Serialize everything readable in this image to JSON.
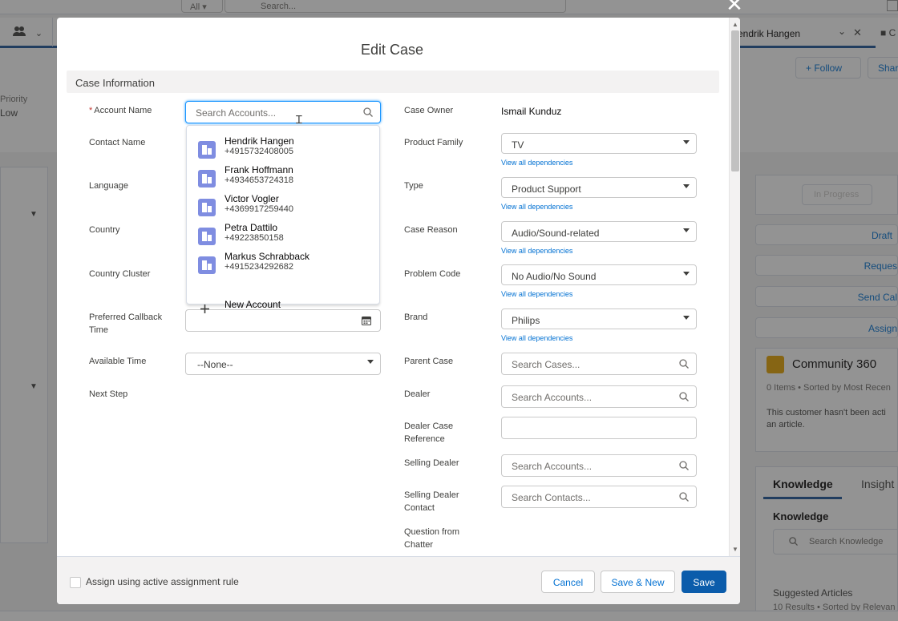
{
  "background": {
    "search_scope": "All",
    "search_placeholder": "Search...",
    "tab_right_label": "endrik Hangen",
    "tab_more_label": "C",
    "priority_label": "Priority",
    "priority_value": "Low",
    "follow_label": "Follow",
    "share_label": "Shar",
    "status_button": "In Progress",
    "actions": [
      "Draft",
      "Reques",
      "Send Cal",
      "Assign"
    ],
    "community_title": "Community 360",
    "community_meta": "0 Items • Sorted by Most Recen",
    "community_text": "This customer hasn't been acti an article.",
    "knowledge_tab": "Knowledge",
    "insights_tab": "Insight",
    "knowledge_heading": "Knowledge",
    "knowledge_search_placeholder": "Search Knowledge",
    "suggested_articles": "Suggested Articles",
    "suggested_meta": "10 Results • Sorted by Relevan"
  },
  "modal": {
    "title": "Edit Case",
    "section_title": "Case Information",
    "left_fields": {
      "account_name_label": "Account Name",
      "account_name_placeholder": "Search Accounts...",
      "contact_name_label": "Contact Name",
      "language_label": "Language",
      "country_label": "Country",
      "country_cluster_label": "Country Cluster",
      "preferred_callback_label": "Preferred Callback Time",
      "available_time_label": "Available Time",
      "available_time_value": "--None--",
      "next_step_label": "Next Step"
    },
    "account_lookup": {
      "results": [
        {
          "name": "Hendrik Hangen",
          "phone": "+4915732408005"
        },
        {
          "name": "Frank Hoffmann",
          "phone": "+4934653724318"
        },
        {
          "name": "Victor Vogler",
          "phone": "+4369917259440"
        },
        {
          "name": "Petra Dattilo",
          "phone": "+49223850158"
        },
        {
          "name": "Markus Schrabback",
          "phone": "+4915234292682"
        }
      ],
      "new_account_label": "New Account"
    },
    "right_fields": {
      "case_owner_label": "Case Owner",
      "case_owner_value": "Ismail Kunduz",
      "product_family_label": "Product Family",
      "product_family_value": "TV",
      "type_label": "Type",
      "type_value": "Product Support",
      "case_reason_label": "Case Reason",
      "case_reason_value": "Audio/Sound-related",
      "problem_code_label": "Problem Code",
      "problem_code_value": "No Audio/No Sound",
      "brand_label": "Brand",
      "brand_value": "Philips",
      "view_dependencies": "View all dependencies",
      "parent_case_label": "Parent Case",
      "parent_case_placeholder": "Search Cases...",
      "dealer_label": "Dealer",
      "dealer_placeholder": "Search Accounts...",
      "dealer_case_ref_label": "Dealer Case Reference",
      "selling_dealer_label": "Selling Dealer",
      "selling_dealer_placeholder": "Search Accounts...",
      "selling_dealer_contact_label": "Selling Dealer Contact",
      "selling_dealer_contact_placeholder": "Search Contacts...",
      "question_from_chatter_label": "Question from Chatter"
    },
    "footer": {
      "assign_rule_label": "Assign using active assignment rule",
      "cancel_label": "Cancel",
      "save_new_label": "Save & New",
      "save_label": "Save"
    }
  },
  "colors": {
    "brand": "#0b5cab",
    "link": "#0070d2",
    "required": "#c23934",
    "account_icon": "#7f8de1"
  }
}
